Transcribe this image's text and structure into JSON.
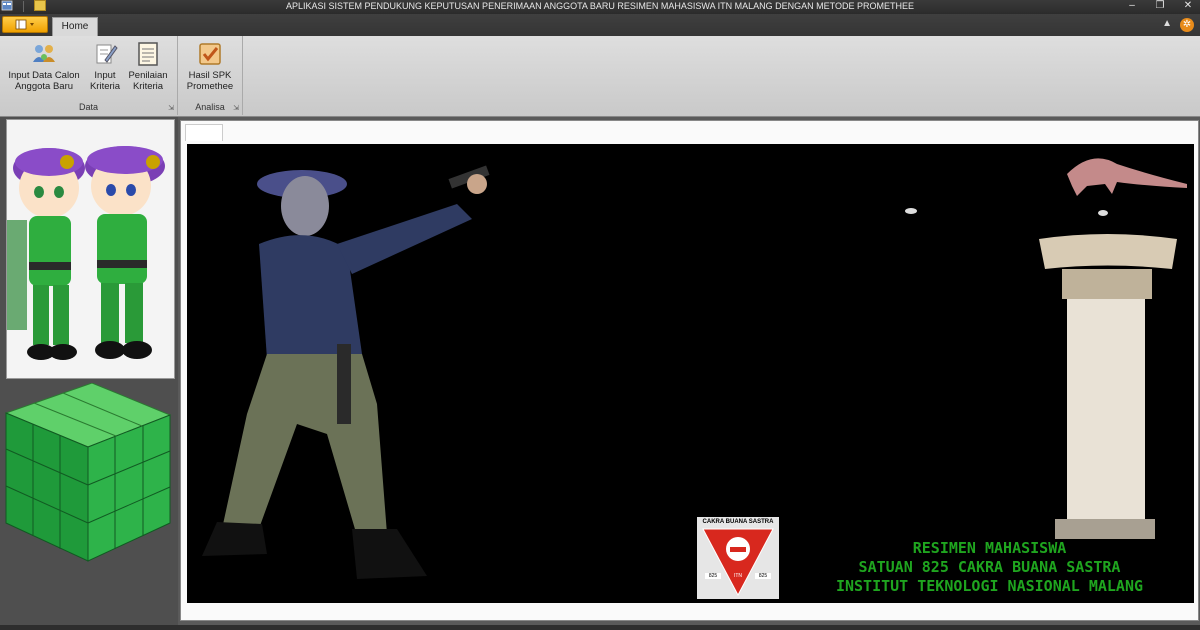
{
  "window": {
    "title": "APLIKASI SISTEM PENDUKUNG KEPUTUSAN PENERIMAAN ANGGOTA BARU RESIMEN MAHASISWA ITN MALANG DENGAN METODE PROMETHEE",
    "minimize": "–",
    "restore": "❐",
    "close": "✕"
  },
  "ribbon": {
    "tabs": [
      {
        "label": "Home"
      }
    ],
    "groups": [
      {
        "label": "Data",
        "buttons": [
          {
            "label": "Input Data Calon Anggota Baru",
            "icon": "users-icon"
          },
          {
            "label": "Input Kriteria",
            "icon": "document-pen-icon"
          },
          {
            "label": "Penilaian Kriteria",
            "icon": "list-form-icon"
          }
        ]
      },
      {
        "label": "Analisa",
        "buttons": [
          {
            "label": "Hasil SPK Promethee",
            "icon": "checkbox-icon"
          }
        ]
      }
    ]
  },
  "splash": {
    "logo_text": "CAKRA BUANA SASTRA",
    "logo_num_left": "825",
    "logo_num_right": "825",
    "logo_center": "ITN",
    "caption_lines": [
      "RESIMEN MAHASISWA",
      "SATUAN 825 CAKRA BUANA SASTRA",
      "INSTITUT TEKNOLOGI NASIONAL MALANG"
    ]
  },
  "colors": {
    "caption_green": "#1fa51f",
    "menu_orange": "#f0a000",
    "beret_purple": "#7a3fb5"
  }
}
